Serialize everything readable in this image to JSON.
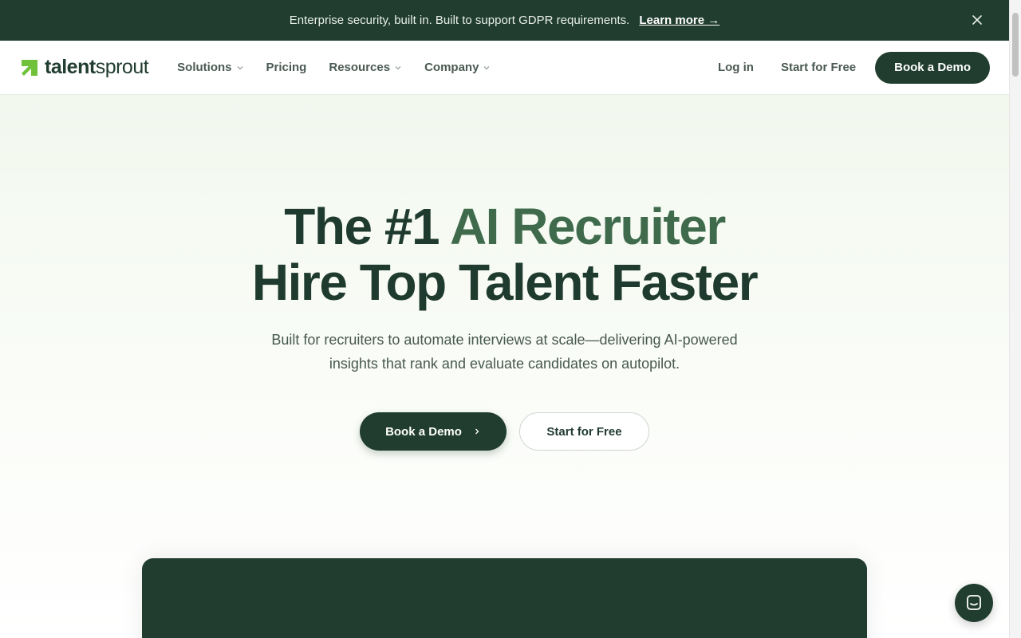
{
  "announcement": {
    "message": "Enterprise security, built in. Built to support GDPR requirements.",
    "link_label": "Learn more →"
  },
  "brand": {
    "name_bold": "talent",
    "name_regular": "sprout",
    "colors": {
      "primary": "#213d2f",
      "accent": "#3f6b4c",
      "logo_green": "#6fc23a"
    }
  },
  "nav": {
    "items": [
      {
        "label": "Solutions",
        "has_dropdown": true
      },
      {
        "label": "Pricing",
        "has_dropdown": false
      },
      {
        "label": "Resources",
        "has_dropdown": true
      },
      {
        "label": "Company",
        "has_dropdown": true
      }
    ],
    "login_label": "Log in",
    "start_free_label": "Start for Free",
    "book_demo_label": "Book a Demo"
  },
  "hero": {
    "headline_part1": "The #1 ",
    "headline_accent": "AI Recruiter",
    "headline_line2": "Hire Top Talent Faster",
    "subhead_line1": "Built for recruiters to automate interviews at scale—delivering AI-powered",
    "subhead_line2": "insights that rank and evaluate candidates on autopilot.",
    "primary_cta": "Book a Demo",
    "secondary_cta": "Start for Free"
  },
  "icons": {
    "close": "close-icon",
    "chevron": "chevron-down-icon",
    "arrow": "chevron-right-icon",
    "chat": "chat-icon"
  }
}
